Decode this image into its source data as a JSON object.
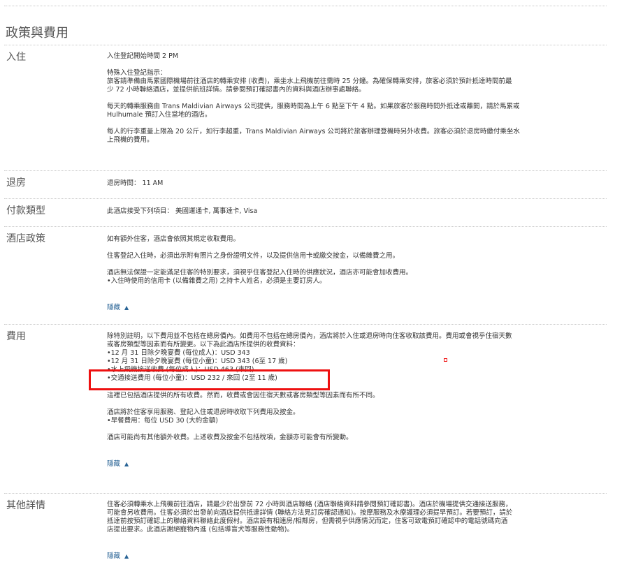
{
  "page_title": "政策與費用",
  "sections": {
    "checkin": {
      "label": "入住",
      "time": "入住登記開始時間 2 PM",
      "special_title": "特殊入住登記指示：",
      "special_l1": "旅客請準備由馬累國際機場前往酒店的轉乘安排 (收費)，乘坐水上飛機前往需時 25 分鐘。為確保轉乘安排，旅客必須於預計抵達時間前最",
      "special_l2": "少 72 小時聯絡酒店，並提供航班詳情。請參閱預訂確認書內的資料與酒店辦事處聯絡。",
      "daily_l1": "每天的轉乘服務由 Trans Maldivian Airways 公司提供，服務時間為上午 6 點至下午 4 點。如果旅客於服務時間外抵達或離開，請於馬累或",
      "daily_l2": "Hulhumale 預訂入住當地的酒店。",
      "luggage_l1": "每人的行李重量上限為 20 公斤，如行李超重，Trans Maldivian Airways 公司將於旅客辦理登機時另外收費。旅客必須於退房時繳付乘坐水",
      "luggage_l2": "上飛機的費用。"
    },
    "checkout": {
      "label": "退房",
      "time": "退房時間： 11 AM"
    },
    "payment": {
      "label": "付款類型",
      "text": "此酒店接受下列項目： 美國運通卡, 萬事達卡, Visa"
    },
    "policy": {
      "label": "酒店政策",
      "p1": "如有額外住客，酒店會依照其規定收取費用。",
      "p2": "住客登記入住時，必須出示附有照片之身份證明文件，以及提供信用卡或繳交按金，以備雜費之用。",
      "p3_l1": "酒店無法保證一定能滿足住客的特別要求，須視乎住客登記入住時的供應狀況，酒店亦可能會加收費用。",
      "p3_l2": "入住時使用的信用卡 (以備雜費之用) 之持卡人姓名，必須是主要訂房人。",
      "hide": "隱藏"
    },
    "fees": {
      "label": "費用",
      "intro_l1": "除特別註明，以下費用並不包括在總房價內。如費用不包括在總房價內，酒店將於入住或退房時向住客收取該費用。費用或會視乎住宿天數",
      "intro_l2": "或客房類型等因素而有所變更。以下為此酒店所提供的收費資料：",
      "fee1": "12 月 31 日除夕晚宴費 (每位成人)：USD 343",
      "fee2": "12 月 31 日除夕晚宴費 (每位小童)：USD 343 (6至 17 歲)",
      "fee3": "水上飛機接送收費 (每位成人)：USD 463 (來回)",
      "fee4": "交通接送費用 (每位小童)：USD 232 / 來回 (2至 11 歲)",
      "p2": "這裡已包括酒店提供的所有收費。然而，收費或會因住宿天數或客房類型等因素而有所不同。",
      "p3_l1": "酒店將於住客享用服務、登記入住或退房時收取下列費用及按金。",
      "p3_l2": "早餐費用：每位 USD 30 (大約金額)",
      "p4": "酒店可能尚有其他額外收費。上述收費及按金不包括稅項，金額亦可能會有所變動。",
      "hide": "隱藏"
    },
    "other": {
      "label": "其他詳情",
      "l1": "住客必須轉乘水上飛機前往酒店，請最少於出發前 72 小時與酒店聯絡 (酒店聯絡資料請參閱預訂確認書)。酒店於機場提供交通接送服務，",
      "l2": "可能會另收費用。住客必須於出發前向酒店提供抵達詳情 (聯絡方法見訂房確認通知)。按摩服務及水療護理必須提早預訂。若要預訂，請於",
      "l3": "抵達前按預訂確認上的聯絡資料聯絡此度假村。酒店設有相連房/相鄰房，但需視乎供應情況而定，住客可致電預訂確認中的電話號碼向酒",
      "l4": "店提出要求。此酒店謝絕寵物內進 (包括導盲犬等服務性動物)。",
      "hide": "隱藏"
    }
  },
  "colors": {
    "link": "#2a6496",
    "highlight": "#ee1111"
  },
  "icons": {
    "hide_caret": "chevron-up-icon"
  }
}
